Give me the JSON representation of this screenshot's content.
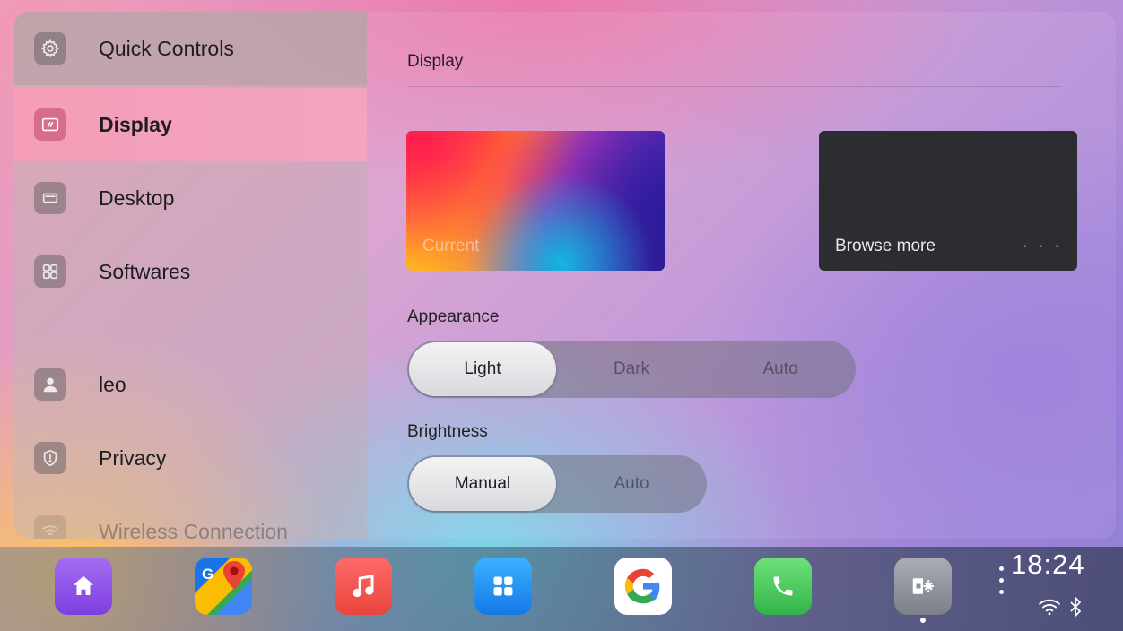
{
  "sidebar": {
    "items": [
      {
        "label": "Quick Controls",
        "icon": "gear-icon"
      },
      {
        "label": "Display",
        "icon": "display-icon"
      },
      {
        "label": "Desktop",
        "icon": "desktop-icon"
      },
      {
        "label": "Softwares",
        "icon": "apps-grid-icon"
      },
      {
        "label": "leo",
        "icon": "user-icon"
      },
      {
        "label": "Privacy",
        "icon": "shield-icon"
      },
      {
        "label": "Wireless Connection",
        "icon": "wifi-icon"
      }
    ]
  },
  "main": {
    "title": "Display",
    "wallpaper": {
      "current_label": "Current",
      "browse_label": "Browse more",
      "more_label": "· · ·"
    },
    "appearance": {
      "label": "Appearance",
      "options": [
        "Light",
        "Dark",
        "Auto"
      ],
      "selected": "Light"
    },
    "brightness": {
      "label": "Brightness",
      "options": [
        "Manual",
        "Auto"
      ],
      "selected": "Manual"
    }
  },
  "dock": {
    "apps": [
      "home-icon",
      "maps-icon",
      "music-icon",
      "app-grid-icon",
      "google-icon",
      "phone-icon",
      "settings-icon"
    ],
    "time": "18:24"
  }
}
